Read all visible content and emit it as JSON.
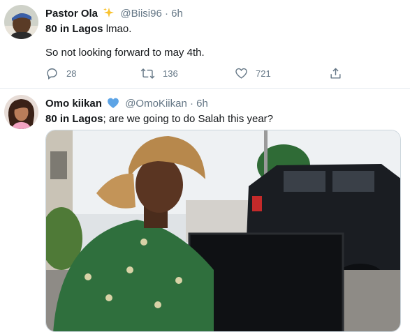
{
  "tweets": [
    {
      "name": "Pastor Ola",
      "badge_icon": "sparkles-icon",
      "handle": "@Biisi96",
      "separator": "·",
      "time": "6h",
      "line1_bold": "80 in Lagos",
      "line1_rest": " lmao.",
      "line2": "So not looking forward to may 4th.",
      "replies": "28",
      "retweets": "136",
      "likes": "721"
    },
    {
      "name": "Omo kiikan",
      "badge_icon": "blue-heart-icon",
      "handle": "@OmoKiikan",
      "separator": "·",
      "time": "6h",
      "line1_bold": "80 in Lagos",
      "line1_rest": "; are we going to do Salah this year?"
    }
  ],
  "colors": {
    "text": "#14171a",
    "muted": "#657786",
    "divider": "#e6ecf0",
    "heart_badge": "#5da4e6",
    "sparkle_badge": "#f9c22e"
  },
  "icons": [
    "reply-icon",
    "retweet-icon",
    "like-icon",
    "share-icon"
  ]
}
